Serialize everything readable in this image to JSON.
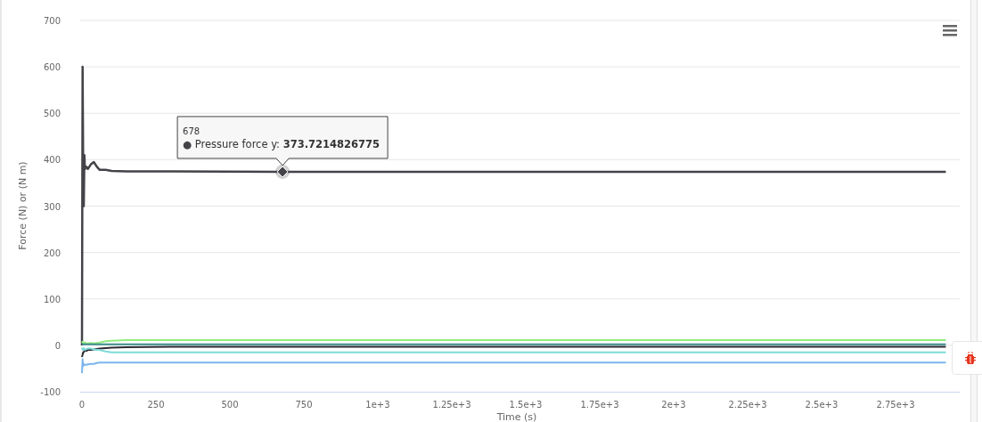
{
  "chart": {
    "chart_data": {
      "type": "line",
      "ylabel": "Force (N) or (N m)",
      "xlabel": "Time (s)",
      "grid": true,
      "x": [
        0,
        2,
        4,
        6,
        8,
        10,
        15,
        20,
        30,
        40,
        50,
        60,
        80,
        100,
        150,
        300,
        678,
        1000,
        2920
      ],
      "series": [
        {
          "name": "Pressure force y",
          "color": "#434348",
          "values": [
            0,
            600,
            400,
            300,
            410,
            380,
            385,
            380,
            390,
            395,
            385,
            378,
            378,
            376,
            375,
            375,
            374,
            374,
            374
          ]
        },
        {
          "color": "#90ed7d",
          "values": [
            5,
            8,
            5,
            3,
            5,
            6,
            4,
            4,
            5,
            4,
            5,
            6,
            9,
            10,
            11,
            11,
            11,
            11,
            11
          ]
        },
        {
          "color": "#3d8c8a",
          "values": [
            2,
            2,
            2,
            2,
            2,
            2,
            2,
            2,
            2,
            2,
            2,
            2,
            2,
            2,
            2,
            2,
            2,
            2,
            2
          ]
        },
        {
          "color": "#2b2b30",
          "values": [
            -25,
            -20,
            -15,
            -15,
            -12,
            -12,
            -12,
            -10,
            -10,
            -9,
            -8,
            -7,
            -6,
            -5,
            -4,
            -3,
            -3,
            -3,
            -3
          ]
        },
        {
          "color": "#7ddbd8",
          "values": [
            -5,
            -10,
            -8,
            -6,
            -8,
            -10,
            -8,
            -7,
            -7,
            -9,
            -10,
            -10,
            -13,
            -15,
            -15,
            -15,
            -15,
            -15,
            -15
          ]
        },
        {
          "color": "#7cb5ec",
          "values": [
            -60,
            -30,
            -45,
            -40,
            -42,
            -42,
            -42,
            -41,
            -40,
            -40,
            -38,
            -37,
            -37,
            -37,
            -37,
            -37,
            -37,
            -37,
            -37
          ]
        }
      ],
      "xlim": [
        0,
        2970
      ],
      "ylim": [
        -100,
        700
      ],
      "xticks": [
        0,
        250,
        500,
        750,
        {
          "value": 1000,
          "label": "1e+3"
        },
        {
          "value": 1250,
          "label": "1.25e+3"
        },
        {
          "value": 1500,
          "label": "1.5e+3"
        },
        {
          "value": 1750,
          "label": "1.75e+3"
        },
        {
          "value": 2000,
          "label": "2e+3"
        },
        {
          "value": 2250,
          "label": "2.25e+3"
        },
        {
          "value": 2500,
          "label": "2.5e+3"
        },
        {
          "value": 2750,
          "label": "2.75e+3"
        }
      ],
      "yticks": [
        -100,
        0,
        100,
        200,
        300,
        400,
        500,
        600,
        700
      ]
    },
    "tooltip": {
      "header": "678",
      "bullet": "●",
      "separator": ":",
      "value": "373.7214826775"
    }
  }
}
